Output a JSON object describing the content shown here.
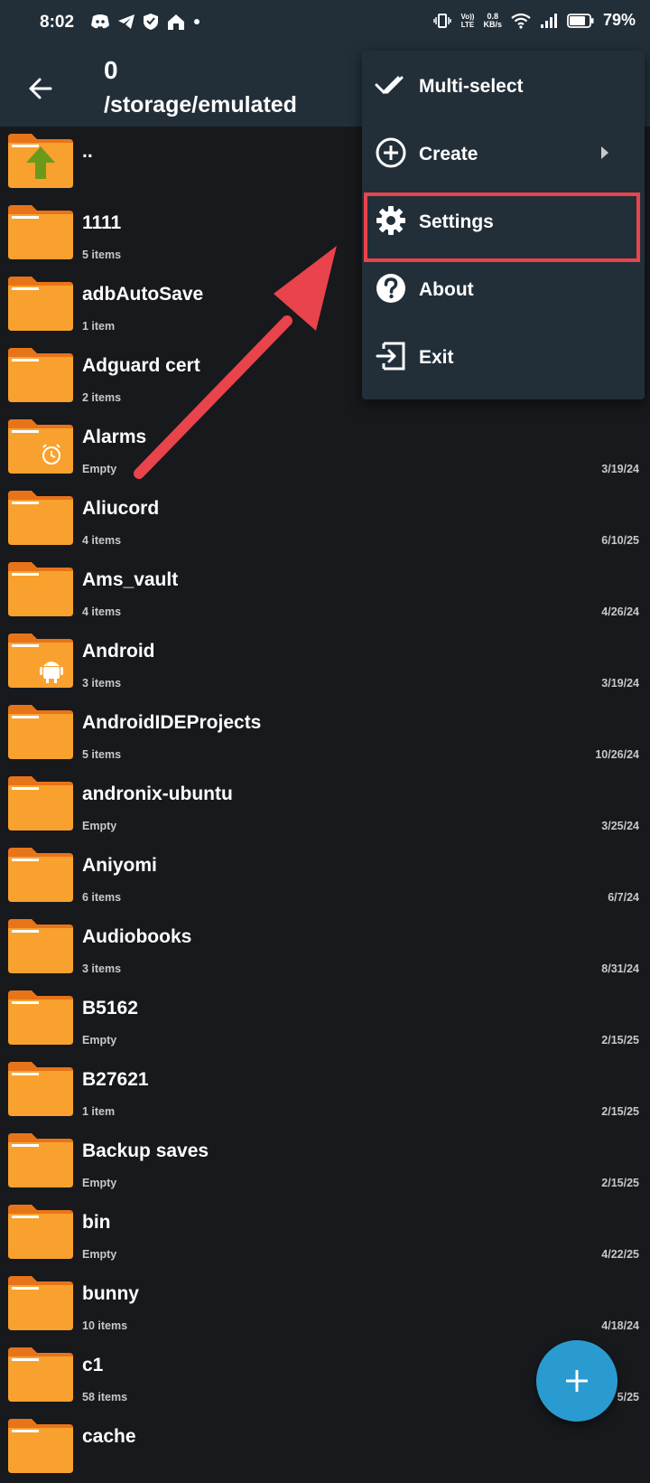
{
  "status_bar": {
    "time": "8:02",
    "network_top": "Vo))",
    "network_bottom": "LTE",
    "speed_top": "0.8",
    "speed_bottom": "KB/s",
    "battery_percent": "79%"
  },
  "app_bar": {
    "title": "0",
    "path": "/storage/emulated"
  },
  "menu": {
    "items": [
      {
        "label": "Multi-select",
        "icon": "double-check-icon"
      },
      {
        "label": "Create",
        "icon": "plus-circle-icon"
      },
      {
        "label": "Settings",
        "icon": "gear-icon"
      },
      {
        "label": "About",
        "icon": "question-circle-icon"
      },
      {
        "label": "Exit",
        "icon": "exit-icon"
      }
    ]
  },
  "files": [
    {
      "name": "..",
      "sub": "",
      "date": "",
      "badge": "up-arrow"
    },
    {
      "name": "1111",
      "sub": "5 items",
      "date": "",
      "badge": ""
    },
    {
      "name": "adbAutoSave",
      "sub": "1 item",
      "date": "",
      "badge": ""
    },
    {
      "name": "Adguard cert",
      "sub": "2 items",
      "date": "",
      "badge": ""
    },
    {
      "name": "Alarms",
      "sub": "Empty",
      "date": "3/19/24",
      "badge": "alarm"
    },
    {
      "name": "Aliucord",
      "sub": "4 items",
      "date": "6/10/25",
      "badge": ""
    },
    {
      "name": "Ams_vault",
      "sub": "4 items",
      "date": "4/26/24",
      "badge": ""
    },
    {
      "name": "Android",
      "sub": "3 items",
      "date": "3/19/24",
      "badge": "android"
    },
    {
      "name": "AndroidIDEProjects",
      "sub": "5 items",
      "date": "10/26/24",
      "badge": ""
    },
    {
      "name": "andronix-ubuntu",
      "sub": "Empty",
      "date": "3/25/24",
      "badge": ""
    },
    {
      "name": "Aniyomi",
      "sub": "6 items",
      "date": "6/7/24",
      "badge": ""
    },
    {
      "name": "Audiobooks",
      "sub": "3 items",
      "date": "8/31/24",
      "badge": ""
    },
    {
      "name": "B5162",
      "sub": "Empty",
      "date": "2/15/25",
      "badge": ""
    },
    {
      "name": "B27621",
      "sub": "1 item",
      "date": "2/15/25",
      "badge": ""
    },
    {
      "name": "Backup saves",
      "sub": "Empty",
      "date": "2/15/25",
      "badge": ""
    },
    {
      "name": "bin",
      "sub": "Empty",
      "date": "4/22/25",
      "badge": ""
    },
    {
      "name": "bunny",
      "sub": "10 items",
      "date": "4/18/24",
      "badge": ""
    },
    {
      "name": "c1",
      "sub": "58 items",
      "date": "5/25",
      "badge": ""
    },
    {
      "name": "cache",
      "sub": "",
      "date": "",
      "badge": ""
    }
  ],
  "colors": {
    "bar": "#222f39",
    "background": "#17191c",
    "folder": "#f9a12e",
    "folder_tab": "#e8741a",
    "highlight": "#e9434b",
    "fab": "#2a9bd1"
  }
}
